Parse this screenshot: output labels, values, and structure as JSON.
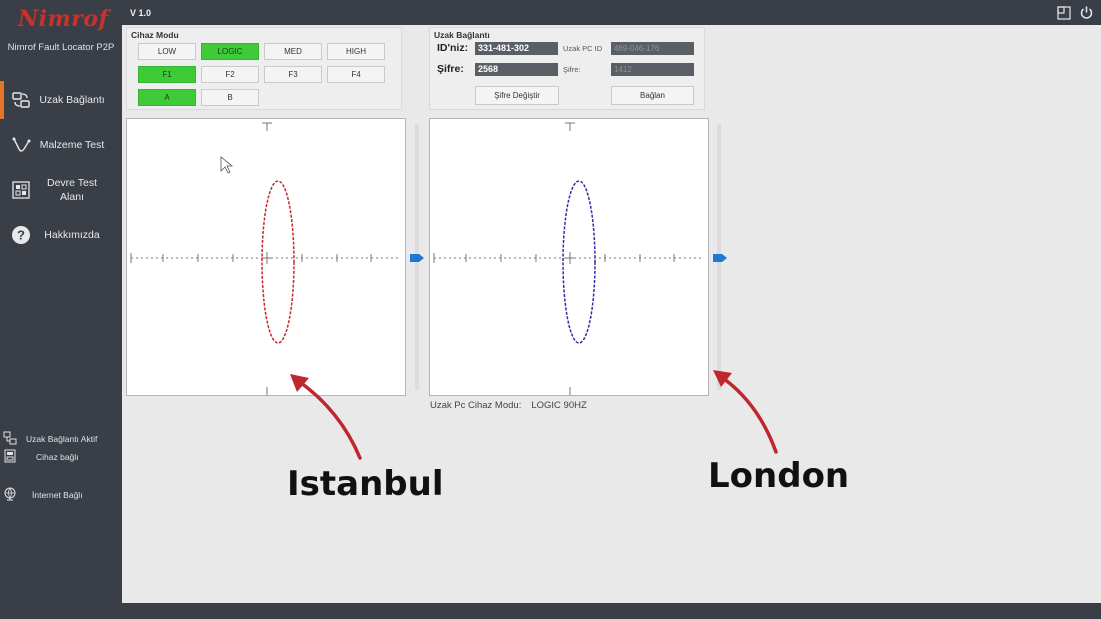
{
  "app": {
    "logo": "Nimrof",
    "name": "Nimrof Fault Locator P2P",
    "version": "V 1.0"
  },
  "sidebar": {
    "items": [
      {
        "label": "Uzak Bağlantı",
        "icon": "remote-connection-icon",
        "active": true
      },
      {
        "label": "Malzeme Test",
        "icon": "probe-icon",
        "active": false
      },
      {
        "label": "Devre Test Alanı",
        "icon": "circuit-icon",
        "active": false
      },
      {
        "label": "Hakkımızda",
        "icon": "help-icon",
        "active": false
      }
    ],
    "status": [
      {
        "label": "Uzak Bağlantı Aktif",
        "icon": "network-icon"
      },
      {
        "label": "Cihaz bağlı",
        "icon": "device-icon"
      },
      {
        "label": "İnternet Bağlı",
        "icon": "globe-icon"
      }
    ]
  },
  "device_mode": {
    "title": "Cihaz Modu",
    "levels": [
      {
        "label": "LOW",
        "active": false
      },
      {
        "label": "LOGIC",
        "active": true
      },
      {
        "label": "MED",
        "active": false
      },
      {
        "label": "HIGH",
        "active": false
      }
    ],
    "frequencies": [
      {
        "label": "F1",
        "active": true
      },
      {
        "label": "F2",
        "active": false
      },
      {
        "label": "F3",
        "active": false
      },
      {
        "label": "F4",
        "active": false
      }
    ],
    "channels": [
      {
        "label": "A",
        "active": true
      },
      {
        "label": "B",
        "active": false
      }
    ]
  },
  "remote": {
    "title": "Uzak Bağlantı",
    "id_label": "ID'niz:",
    "id_value": "331-481-302",
    "password_label": "Şifre:",
    "password_value": "2568",
    "remote_id_label": "Uzak PC ID",
    "remote_id_value": "469-046-176",
    "remote_password_label": "Şifre:",
    "remote_password_value": "1412",
    "change_password": "Şifre Değiştir",
    "connect": "Bağlan"
  },
  "remote_mode": {
    "label": "Uzak Pc Cihaz Modu:",
    "value": "LOGIC 90HZ"
  },
  "annotations": {
    "left_city": "Istanbul",
    "right_city": "London"
  },
  "colors": {
    "accent_green": "#3fca3a",
    "sidebar": "#3a3f47",
    "active_indicator": "#e8742a",
    "local_trace": "#c62828",
    "remote_trace": "#2e2ea8",
    "marker_blue": "#1f78d1",
    "annotation_arrow": "#c0272d"
  }
}
